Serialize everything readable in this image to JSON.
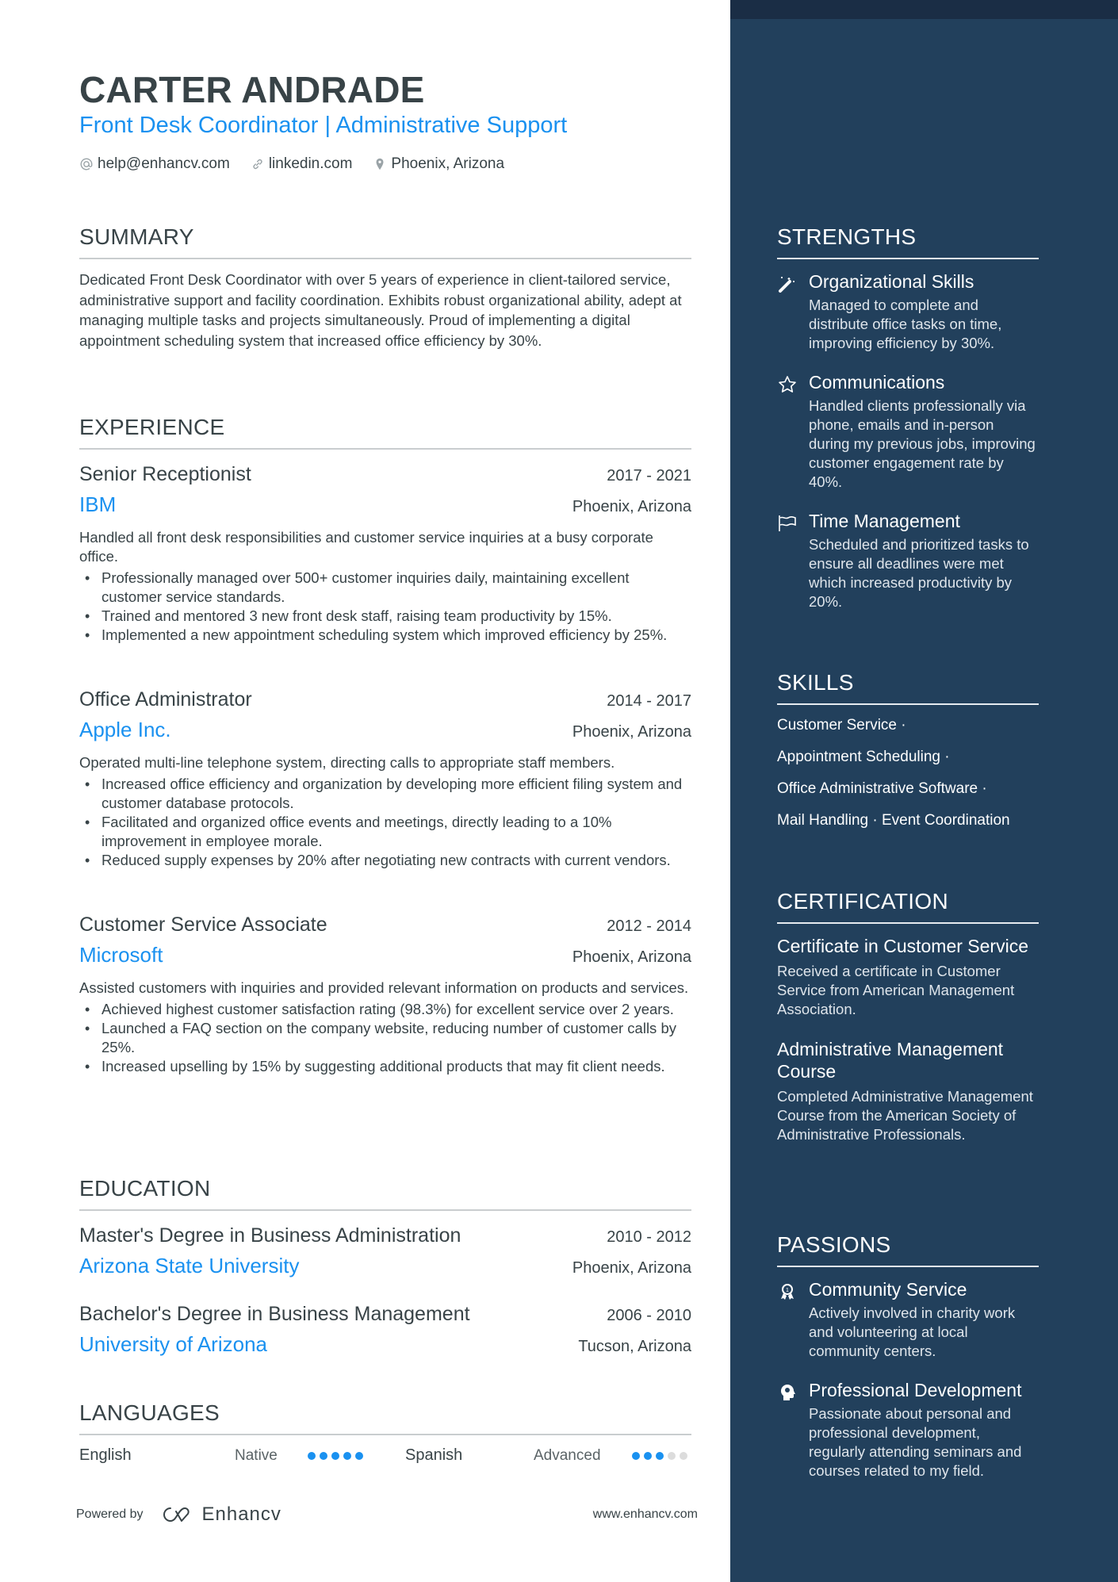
{
  "header": {
    "name": "CARTER ANDRADE",
    "title": "Front Desk Coordinator | Administrative Support",
    "contacts": [
      {
        "icon": "at-icon",
        "text": "help@enhancv.com"
      },
      {
        "icon": "link-icon",
        "text": "linkedin.com"
      },
      {
        "icon": "location-pin-icon",
        "text": "Phoenix, Arizona"
      }
    ]
  },
  "summary": {
    "heading": "SUMMARY",
    "text": "Dedicated Front Desk Coordinator with over 5 years of experience in client-tailored service, administrative support and facility coordination. Exhibits robust organizational ability, adept at managing multiple tasks and projects simultaneously. Proud of implementing a digital appointment scheduling system that increased office efficiency by 30%."
  },
  "experience": {
    "heading": "EXPERIENCE",
    "jobs": [
      {
        "role": "Senior Receptionist",
        "dates": "2017 - 2021",
        "company": "IBM",
        "location": "Phoenix, Arizona",
        "description": "Handled all front desk responsibilities and customer service inquiries at a busy corporate office.",
        "bullets": [
          "Professionally managed over 500+ customer inquiries daily, maintaining excellent customer service standards.",
          "Trained and mentored 3 new front desk staff, raising team productivity by 15%.",
          "Implemented a new appointment scheduling system which improved efficiency by 25%."
        ]
      },
      {
        "role": "Office Administrator",
        "dates": "2014 - 2017",
        "company": "Apple Inc.",
        "location": "Phoenix, Arizona",
        "description": "Operated multi-line telephone system, directing calls to appropriate staff members.",
        "bullets": [
          "Increased office efficiency and organization by developing more efficient filing system and customer database protocols.",
          "Facilitated and organized office events and meetings, directly leading to a 10% improvement in employee morale.",
          "Reduced supply expenses by 20% after negotiating new contracts with current vendors."
        ]
      },
      {
        "role": "Customer Service Associate",
        "dates": "2012 - 2014",
        "company": "Microsoft",
        "location": "Phoenix, Arizona",
        "description": "Assisted customers with inquiries and provided relevant information on products and services.",
        "bullets": [
          "Achieved highest customer satisfaction rating (98.3%) for excellent service over 2 years.",
          "Launched a FAQ section on the company website, reducing number of customer calls by 25%.",
          "Increased upselling by 15% by suggesting additional products that may fit client needs."
        ]
      }
    ]
  },
  "education": {
    "heading": "EDUCATION",
    "items": [
      {
        "degree": "Master's Degree in Business Administration",
        "dates": "2010 - 2012",
        "school": "Arizona State University",
        "location": "Phoenix, Arizona"
      },
      {
        "degree": "Bachelor's Degree in Business Management",
        "dates": "2006 - 2010",
        "school": "University of Arizona",
        "location": "Tucson, Arizona"
      }
    ]
  },
  "languages": {
    "heading": "LANGUAGES",
    "items": [
      {
        "name": "English",
        "level": "Native",
        "rating": 5,
        "max": 5
      },
      {
        "name": "Spanish",
        "level": "Advanced",
        "rating": 3,
        "max": 5
      }
    ]
  },
  "footer": {
    "powered_by": "Powered by",
    "brand": "Enhancv",
    "url": "www.enhancv.com"
  },
  "strengths": {
    "heading": "STRENGTHS",
    "items": [
      {
        "icon": "magic-wand-icon",
        "title": "Organizational Skills",
        "description": "Managed to complete and distribute office tasks on time, improving efficiency by 30%."
      },
      {
        "icon": "star-icon",
        "title": "Communications",
        "description": "Handled clients professionally via phone, emails and in-person during my previous jobs, improving customer engagement rate by 40%."
      },
      {
        "icon": "flag-icon",
        "title": "Time Management",
        "description": "Scheduled and prioritized tasks to ensure all deadlines were met which increased productivity by 20%."
      }
    ]
  },
  "skills": {
    "heading": "SKILLS",
    "lines": [
      "Customer Service ·",
      "Appointment Scheduling ·",
      "Office Administrative Software ·",
      "Mail Handling · Event Coordination"
    ]
  },
  "certification": {
    "heading": "CERTIFICATION",
    "items": [
      {
        "title": "Certificate in Customer Service",
        "description": "Received a certificate in Customer Service from American Management Association."
      },
      {
        "title": "Administrative Management Course",
        "description": "Completed Administrative Management Course from the American Society of Administrative Professionals."
      }
    ]
  },
  "passions": {
    "heading": "PASSIONS",
    "items": [
      {
        "icon": "award-ribbon-icon",
        "title": "Community Service",
        "description": "Actively involved in charity work and volunteering at local community centers."
      },
      {
        "icon": "head-profile-icon",
        "title": "Professional Development",
        "description": "Passionate about personal and professional development, regularly attending seminars and courses related to my field."
      }
    ]
  },
  "colors": {
    "accent": "#1a91f0",
    "sidebar": "#22405c",
    "sidebar_top": "#1a2d45",
    "text": "#384347"
  }
}
